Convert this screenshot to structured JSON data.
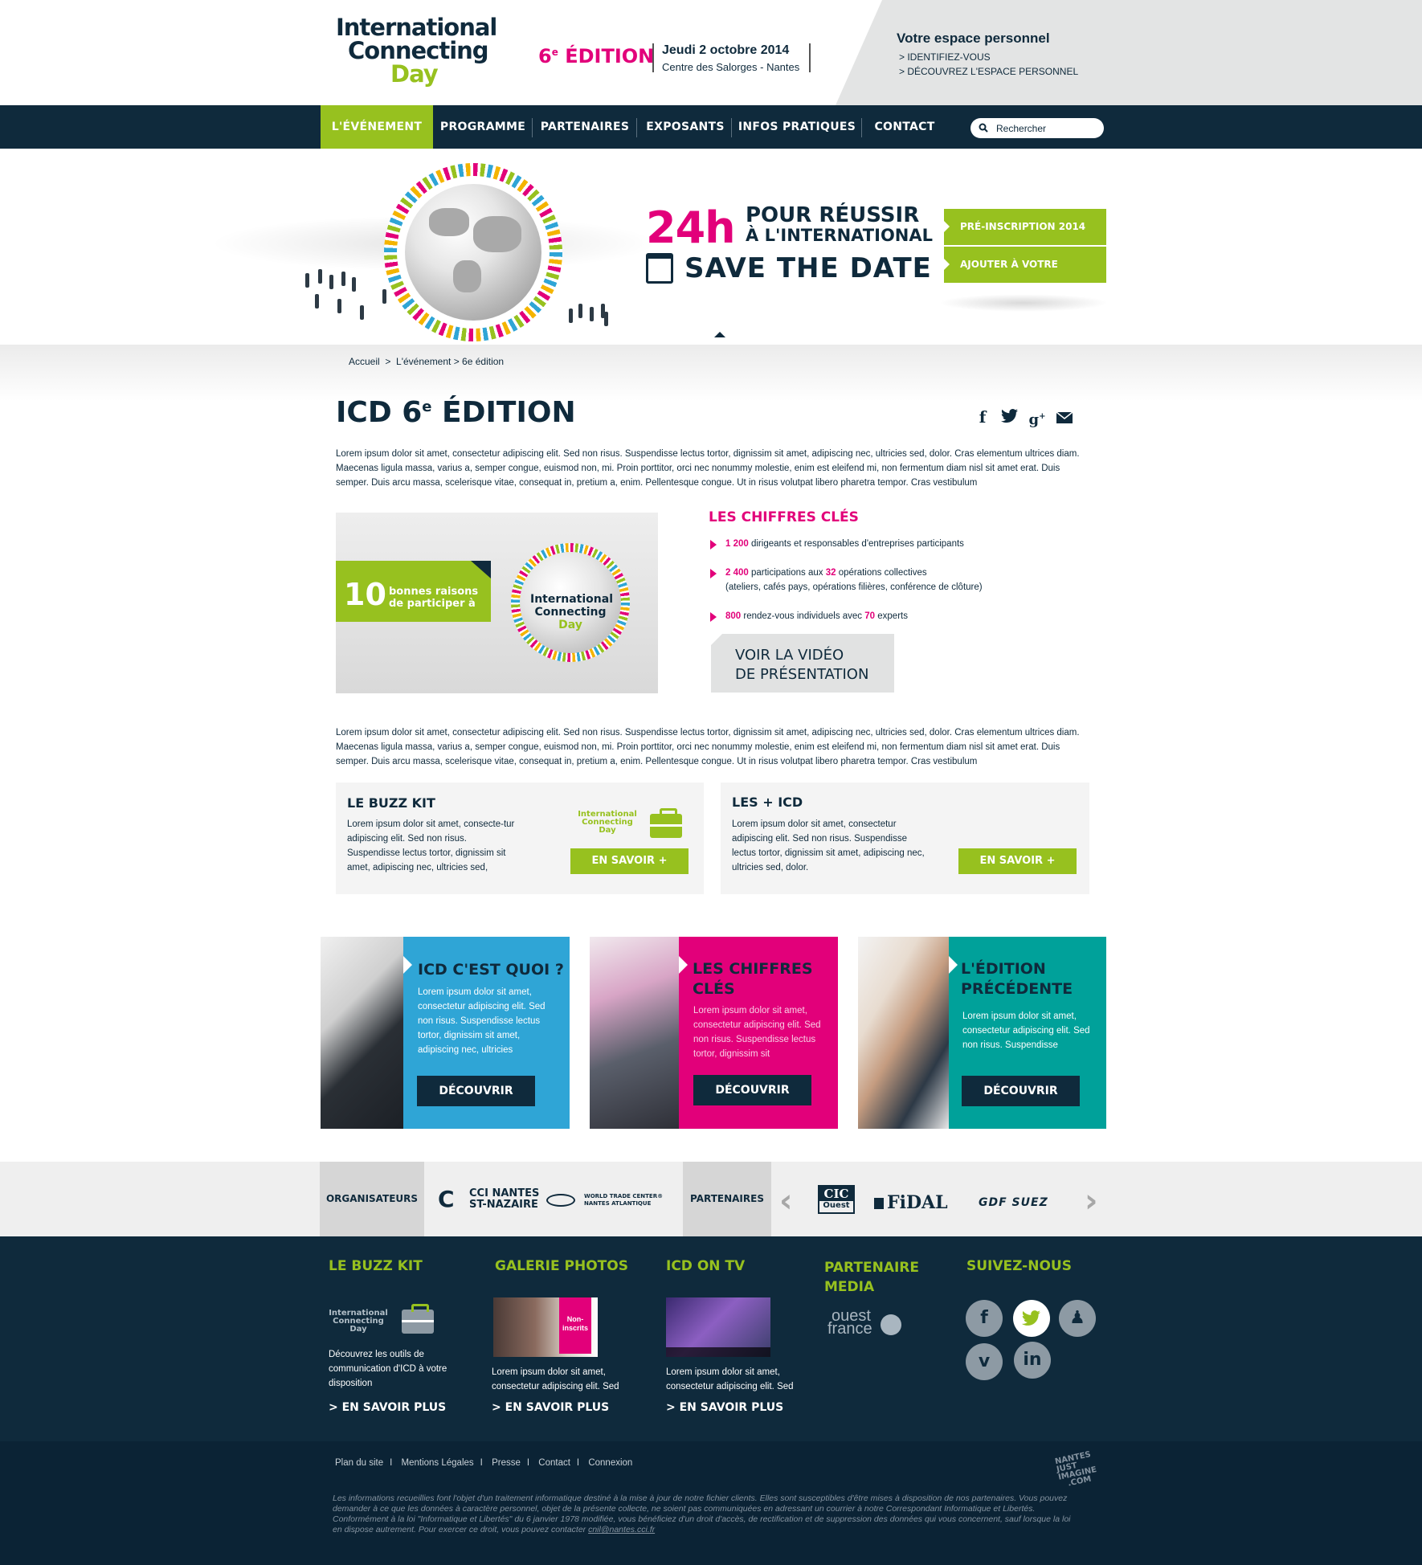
{
  "header": {
    "logo": {
      "line1": "International",
      "line2": "Connecting",
      "line3": "Day"
    },
    "edition": {
      "num": "6",
      "sup": "e",
      "label": "ÉDITION"
    },
    "date": "Jeudi 2 octobre 2014",
    "place": "Centre des Salorges - Nantes",
    "espace": {
      "title": "Votre espace personnel",
      "link1": "> IDENTIFIEZ-VOUS",
      "link2": "> DÉCOUVREZ L'ESPACE PERSONNEL"
    }
  },
  "nav": {
    "items": [
      "L'ÉVÉNEMENT",
      "PROGRAMME",
      "PARTENAIRES",
      "EXPOSANTS",
      "INFOS PRATIQUES",
      "CONTACT"
    ],
    "search_placeholder": "Rechercher"
  },
  "hero": {
    "h24": "24h",
    "pour1": "POUR RÉUSSIR",
    "pour2": "À L'INTERNATIONAL",
    "save": "SAVE THE DATE",
    "btn1": "PRÉ-INSCRIPTION 2014",
    "btn2": "AJOUTER À VOTRE AGENDA"
  },
  "breadcrumb": "Accueil  >  L'événement > 6e édition",
  "page": {
    "title_pre": "ICD 6",
    "title_sup": "e",
    "title_post": " ÉDITION",
    "para1": "Lorem ipsum dolor sit amet, consectetur adipiscing elit. Sed non risus. Suspendisse lectus tortor, dignissim sit amet, adipiscing nec, ultricies sed, dolor. Cras elementum ultrices diam. Maecenas ligula massa, varius a, semper congue, euismod non, mi. Proin porttitor, orci nec nonummy molestie, enim est eleifend mi, non fermentum diam nisl sit amet erat. Duis semper. Duis arcu massa, scelerisque vitae, consequat in, pretium a, enim. Pellentesque congue. Ut in risus volutpat libero pharetra tempor. Cras vestibulum",
    "para2": "Lorem ipsum dolor sit amet, consectetur adipiscing elit. Sed non risus. Suspendisse lectus tortor, dignissim sit amet, adipiscing nec, ultricies sed, dolor. Cras elementum ultrices diam. Maecenas ligula massa, varius a, semper congue, euismod non, mi. Proin porttitor, orci nec nonummy molestie, enim est eleifend mi, non fermentum diam nisl sit amet erat. Duis semper. Duis arcu massa, scelerisque vitae, consequat in, pretium a, enim. Pellentesque congue. Ut in risus volutpat libero pharetra tempor. Cras vestibulum"
  },
  "video": {
    "num": "10",
    "text1": "bonnes raisons",
    "text2": "de participer à",
    "logo1": "International",
    "logo2": "Connecting",
    "logo3": "Day",
    "button_line1": "VOIR LA VIDÉO",
    "button_line2": "DE PRÉSENTATION"
  },
  "key_figures": {
    "title": "LES CHIFFRES CLÉS",
    "item1": {
      "n": "1 200",
      "t": "dirigeants et responsables d'entreprises participants"
    },
    "item2": {
      "n": "2 400",
      "t1": "participations aux",
      "n2": "32",
      "t2": "opérations collectives",
      "t3": "(ateliers, cafés pays, opérations filières, conférence de clôture)"
    },
    "item3": {
      "n": "800",
      "t1": "rendez-vous individuels avec",
      "n2": "70",
      "t2": "experts"
    }
  },
  "boxes": {
    "buzz": {
      "title": "LE BUZZ KIT",
      "text": "Lorem ipsum dolor sit amet, consecte-tur adipiscing elit. Sed non risus. Suspendisse lectus tortor, dignissim sit amet, adipiscing nec, ultricies sed,",
      "logo1": "International",
      "logo2": "Connecting",
      "logo3": "Day",
      "button": "EN SAVOIR +"
    },
    "plus": {
      "title": "LES + ICD",
      "text": "Lorem ipsum dolor sit amet, consectetur adipiscing elit. Sed non risus. Suspendisse lectus tortor, dignissim sit amet, adipiscing nec, ultricies sed, dolor.",
      "button": "EN SAVOIR +"
    }
  },
  "cards": [
    {
      "title": "ICD C'EST QUOI ?",
      "text": "Lorem ipsum dolor sit amet, consectetur adipiscing elit. Sed non risus. Suspendisse lectus tortor, dignissim sit amet, adipiscing nec, ultricies",
      "button": "DÉCOUVRIR",
      "color": "#2fa5d6"
    },
    {
      "title1": "LES CHIFFRES",
      "title2": "CLÉS",
      "text": "Lorem ipsum dolor sit amet, consectetur adipiscing elit. Sed non risus. Suspendisse lectus tortor, dignissim sit",
      "button": "DÉCOUVRIR",
      "color": "#e2007a"
    },
    {
      "title1": "L'ÉDITION",
      "title2": "PRÉCÉDENTE",
      "text": "Lorem ipsum dolor sit amet, consectetur adipiscing elit. Sed non risus. Suspendisse",
      "button": "DÉCOUVRIR",
      "color": "#00a19a"
    }
  ],
  "partners": {
    "org_label": "ORGANISATEURS",
    "org1_a": "CCI NANTES",
    "org1_b": "ST-NAZAIRE",
    "org2_a": "WORLD TRADE CENTER®",
    "org2_b": "NANTES ATLANTIQUE",
    "part_label": "PARTENAIRES",
    "p1_a": "CIC",
    "p1_b": "Ouest",
    "p2": "FiDAL",
    "p3": "GDF SUEZ"
  },
  "footer": {
    "buzz": {
      "title": "LE BUZZ KIT",
      "logo1": "International",
      "logo2": "Connecting",
      "logo3": "Day",
      "text": "Découvrez les outils de communication d'ICD à votre disposition",
      "link": "> EN SAVOIR PLUS"
    },
    "galerie": {
      "title": "GALERIE PHOTOS",
      "text": "Lorem ipsum dolor sit amet, consectetur adipiscing elit. Sed",
      "link": "> EN SAVOIR PLUS",
      "sign1": "Non-",
      "sign2": "inscrits"
    },
    "tv": {
      "title": "ICD ON TV",
      "text": "Lorem ipsum dolor sit amet, consectetur adipiscing elit. Sed",
      "link": "> EN SAVOIR PLUS"
    },
    "media": {
      "title1": "PARTENAIRE",
      "title2": "MEDIA",
      "logo1": "ouest",
      "logo2": "france"
    },
    "social": {
      "title": "SUIVEZ-NOUS",
      "icons": [
        "f",
        "t",
        "♟",
        "v",
        "in"
      ]
    },
    "legal_links": [
      "Plan du site",
      "Mentions Légales",
      "Presse",
      "Contact",
      "Connexion"
    ],
    "legal_text": "Les informations recueillies font l'objet d'un traitement informatique destiné à la mise à jour de notre fichier clients. Elles sont susceptibles d'être mises à disposition de nos partenaires. Vous pouvez demander à ce que les données à caractère personnel, objet de la présente collecte, ne soient pas communiquées en adressant un courrier à notre Correspondant Informatique et Libertés. Conformément à la loi \"Informatique et Libertés\" du 6 janvier 1978 modifiée, vous bénéficiez d'un droit d'accès, de rectification et de suppression des données qui vous concernent, sauf lorsque la loi en dispose autrement. Pour exercer ce droit, vous pouvez contacter",
    "legal_email": "cnil@nantes.cci.fr",
    "nji": {
      "l1": "NANTES",
      "l2": "JUST",
      "l3": "IMAGINE",
      "l4": ".COM"
    }
  },
  "colors": {
    "navy": "#0f2a3c",
    "green": "#97c11f",
    "pink": "#e2007a",
    "blue": "#2fa5d6",
    "teal": "#00a19a"
  }
}
